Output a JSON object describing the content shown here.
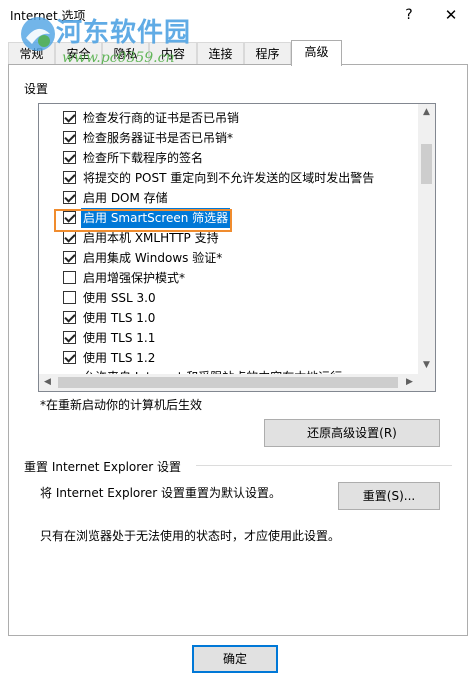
{
  "window": {
    "title": "Internet 选项",
    "help_glyph": "?",
    "close_glyph": "✕"
  },
  "watermark": {
    "site_name": "河东软件园",
    "url": "www.pc0359.cn"
  },
  "tabs": [
    {
      "label": "常规",
      "active": false
    },
    {
      "label": "安全",
      "active": false
    },
    {
      "label": "隐私",
      "active": false
    },
    {
      "label": "内容",
      "active": false
    },
    {
      "label": "连接",
      "active": false
    },
    {
      "label": "程序",
      "active": false
    },
    {
      "label": "高级",
      "active": true
    }
  ],
  "settings": {
    "label": "设置",
    "items": [
      {
        "label": "检查发行商的证书是否已吊销",
        "checked": true
      },
      {
        "label": "检查服务器证书是否已吊销*",
        "checked": true
      },
      {
        "label": "检查所下载程序的签名",
        "checked": true
      },
      {
        "label": "将提交的 POST 重定向到不允许发送的区域时发出警告",
        "checked": true
      },
      {
        "label": "启用 DOM 存储",
        "checked": true
      },
      {
        "label": "启用 SmartScreen 筛选器",
        "checked": true,
        "selected": true
      },
      {
        "label": "启用本机 XMLHTTP 支持",
        "checked": true
      },
      {
        "label": "启用集成 Windows 验证*",
        "checked": true
      },
      {
        "label": "启用增强保护模式*",
        "checked": false
      },
      {
        "label": "使用 SSL 3.0",
        "checked": false
      },
      {
        "label": "使用 TLS 1.0",
        "checked": true
      },
      {
        "label": "使用 TLS 1.1",
        "checked": true
      },
      {
        "label": "使用 TLS 1.2",
        "checked": true
      }
    ],
    "partial_row": "允许来自 Internet 和受限站点的内容在本地运行",
    "restart_note": "*在重新启动你的计算机后生效",
    "restore_button": "还原高级设置(R)"
  },
  "reset_group": {
    "title": "重置 Internet Explorer 设置",
    "description": "将 Internet Explorer 设置重置为默认设置。",
    "reset_button": "重置(S)...",
    "note": "只有在浏览器处于无法使用的状态时，才应使用此设置。"
  },
  "footer": {
    "ok_button": "确定"
  }
}
